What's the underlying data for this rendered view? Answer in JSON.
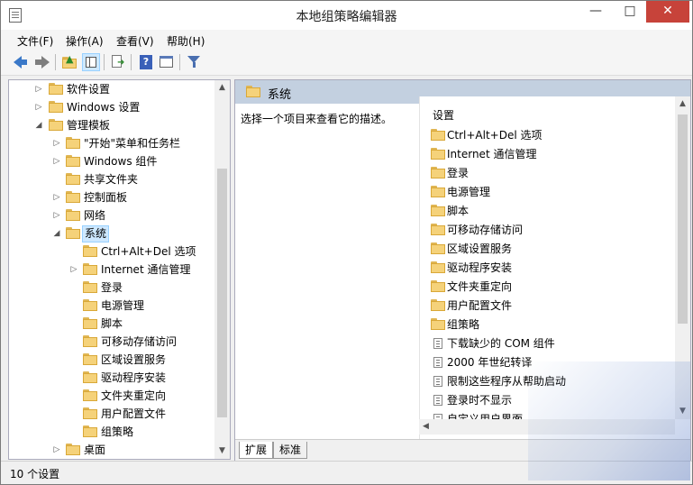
{
  "window": {
    "title": "本地组策略编辑器",
    "controls": {
      "minimize": "—",
      "maximize": "□",
      "close": "✕"
    }
  },
  "menubar": {
    "items": [
      "文件(F)",
      "操作(A)",
      "查看(V)",
      "帮助(H)"
    ]
  },
  "toolbar": {
    "icons": [
      "back-arrow-icon",
      "forward-arrow-icon",
      "up-folder-icon",
      "show-hide-tree-icon",
      "export-list-icon",
      "help-icon",
      "properties-icon",
      "filter-icon"
    ]
  },
  "tree": {
    "items": [
      {
        "label": "软件设置",
        "expander": "▷"
      },
      {
        "label": "Windows 设置",
        "expander": "▷"
      },
      {
        "label": "管理模板",
        "expander": "◢"
      },
      {
        "label": "\"开始\"菜单和任务栏",
        "expander": "▷"
      },
      {
        "label": "Windows 组件",
        "expander": "▷"
      },
      {
        "label": "共享文件夹",
        "expander": ""
      },
      {
        "label": "控制面板",
        "expander": "▷"
      },
      {
        "label": "网络",
        "expander": "▷"
      },
      {
        "label": "系统",
        "expander": "◢"
      },
      {
        "label": "Ctrl+Alt+Del 选项",
        "expander": ""
      },
      {
        "label": "Internet 通信管理",
        "expander": "▷"
      },
      {
        "label": "登录",
        "expander": ""
      },
      {
        "label": "电源管理",
        "expander": ""
      },
      {
        "label": "脚本",
        "expander": ""
      },
      {
        "label": "可移动存储访问",
        "expander": ""
      },
      {
        "label": "区域设置服务",
        "expander": ""
      },
      {
        "label": "驱动程序安装",
        "expander": ""
      },
      {
        "label": "文件夹重定向",
        "expander": ""
      },
      {
        "label": "用户配置文件",
        "expander": ""
      },
      {
        "label": "组策略",
        "expander": ""
      },
      {
        "label": "桌面",
        "expander": "▷"
      }
    ]
  },
  "right_pane": {
    "header_title": "系统",
    "description": "选择一个项目来查看它的描述。",
    "list_header": "设置",
    "folders": [
      "Ctrl+Alt+Del 选项",
      "Internet 通信管理",
      "登录",
      "电源管理",
      "脚本",
      "可移动存储访问",
      "区域设置服务",
      "驱动程序安装",
      "文件夹重定向",
      "用户配置文件",
      "组策略"
    ],
    "settings": [
      "下载缺少的 COM 组件",
      "2000 年世纪转译",
      "限制这些程序从帮助启动",
      "登录时不显示",
      "自定义用户界面"
    ]
  },
  "tabs": [
    "扩展",
    "标准"
  ],
  "status": {
    "text": "10 个设置"
  }
}
